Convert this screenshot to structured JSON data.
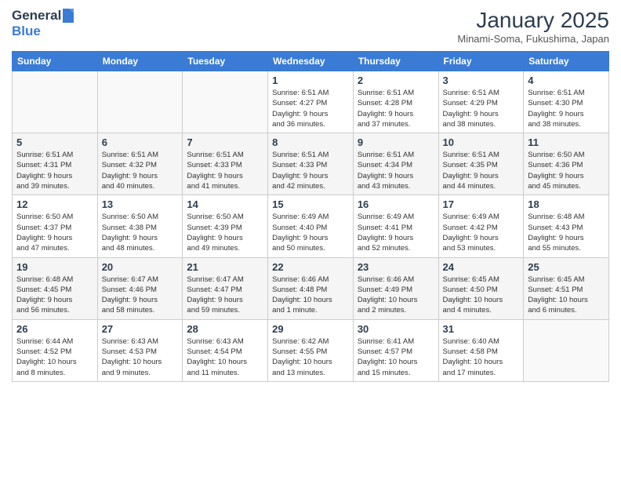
{
  "header": {
    "logo_general": "General",
    "logo_blue": "Blue",
    "title": "January 2025",
    "location": "Minami-Soma, Fukushima, Japan"
  },
  "days_of_week": [
    "Sunday",
    "Monday",
    "Tuesday",
    "Wednesday",
    "Thursday",
    "Friday",
    "Saturday"
  ],
  "weeks": [
    {
      "cells": [
        {
          "day": "",
          "info": ""
        },
        {
          "day": "",
          "info": ""
        },
        {
          "day": "",
          "info": ""
        },
        {
          "day": "1",
          "info": "Sunrise: 6:51 AM\nSunset: 4:27 PM\nDaylight: 9 hours\nand 36 minutes."
        },
        {
          "day": "2",
          "info": "Sunrise: 6:51 AM\nSunset: 4:28 PM\nDaylight: 9 hours\nand 37 minutes."
        },
        {
          "day": "3",
          "info": "Sunrise: 6:51 AM\nSunset: 4:29 PM\nDaylight: 9 hours\nand 38 minutes."
        },
        {
          "day": "4",
          "info": "Sunrise: 6:51 AM\nSunset: 4:30 PM\nDaylight: 9 hours\nand 38 minutes."
        }
      ]
    },
    {
      "cells": [
        {
          "day": "5",
          "info": "Sunrise: 6:51 AM\nSunset: 4:31 PM\nDaylight: 9 hours\nand 39 minutes."
        },
        {
          "day": "6",
          "info": "Sunrise: 6:51 AM\nSunset: 4:32 PM\nDaylight: 9 hours\nand 40 minutes."
        },
        {
          "day": "7",
          "info": "Sunrise: 6:51 AM\nSunset: 4:33 PM\nDaylight: 9 hours\nand 41 minutes."
        },
        {
          "day": "8",
          "info": "Sunrise: 6:51 AM\nSunset: 4:33 PM\nDaylight: 9 hours\nand 42 minutes."
        },
        {
          "day": "9",
          "info": "Sunrise: 6:51 AM\nSunset: 4:34 PM\nDaylight: 9 hours\nand 43 minutes."
        },
        {
          "day": "10",
          "info": "Sunrise: 6:51 AM\nSunset: 4:35 PM\nDaylight: 9 hours\nand 44 minutes."
        },
        {
          "day": "11",
          "info": "Sunrise: 6:50 AM\nSunset: 4:36 PM\nDaylight: 9 hours\nand 45 minutes."
        }
      ]
    },
    {
      "cells": [
        {
          "day": "12",
          "info": "Sunrise: 6:50 AM\nSunset: 4:37 PM\nDaylight: 9 hours\nand 47 minutes."
        },
        {
          "day": "13",
          "info": "Sunrise: 6:50 AM\nSunset: 4:38 PM\nDaylight: 9 hours\nand 48 minutes."
        },
        {
          "day": "14",
          "info": "Sunrise: 6:50 AM\nSunset: 4:39 PM\nDaylight: 9 hours\nand 49 minutes."
        },
        {
          "day": "15",
          "info": "Sunrise: 6:49 AM\nSunset: 4:40 PM\nDaylight: 9 hours\nand 50 minutes."
        },
        {
          "day": "16",
          "info": "Sunrise: 6:49 AM\nSunset: 4:41 PM\nDaylight: 9 hours\nand 52 minutes."
        },
        {
          "day": "17",
          "info": "Sunrise: 6:49 AM\nSunset: 4:42 PM\nDaylight: 9 hours\nand 53 minutes."
        },
        {
          "day": "18",
          "info": "Sunrise: 6:48 AM\nSunset: 4:43 PM\nDaylight: 9 hours\nand 55 minutes."
        }
      ]
    },
    {
      "cells": [
        {
          "day": "19",
          "info": "Sunrise: 6:48 AM\nSunset: 4:45 PM\nDaylight: 9 hours\nand 56 minutes."
        },
        {
          "day": "20",
          "info": "Sunrise: 6:47 AM\nSunset: 4:46 PM\nDaylight: 9 hours\nand 58 minutes."
        },
        {
          "day": "21",
          "info": "Sunrise: 6:47 AM\nSunset: 4:47 PM\nDaylight: 9 hours\nand 59 minutes."
        },
        {
          "day": "22",
          "info": "Sunrise: 6:46 AM\nSunset: 4:48 PM\nDaylight: 10 hours\nand 1 minute."
        },
        {
          "day": "23",
          "info": "Sunrise: 6:46 AM\nSunset: 4:49 PM\nDaylight: 10 hours\nand 2 minutes."
        },
        {
          "day": "24",
          "info": "Sunrise: 6:45 AM\nSunset: 4:50 PM\nDaylight: 10 hours\nand 4 minutes."
        },
        {
          "day": "25",
          "info": "Sunrise: 6:45 AM\nSunset: 4:51 PM\nDaylight: 10 hours\nand 6 minutes."
        }
      ]
    },
    {
      "cells": [
        {
          "day": "26",
          "info": "Sunrise: 6:44 AM\nSunset: 4:52 PM\nDaylight: 10 hours\nand 8 minutes."
        },
        {
          "day": "27",
          "info": "Sunrise: 6:43 AM\nSunset: 4:53 PM\nDaylight: 10 hours\nand 9 minutes."
        },
        {
          "day": "28",
          "info": "Sunrise: 6:43 AM\nSunset: 4:54 PM\nDaylight: 10 hours\nand 11 minutes."
        },
        {
          "day": "29",
          "info": "Sunrise: 6:42 AM\nSunset: 4:55 PM\nDaylight: 10 hours\nand 13 minutes."
        },
        {
          "day": "30",
          "info": "Sunrise: 6:41 AM\nSunset: 4:57 PM\nDaylight: 10 hours\nand 15 minutes."
        },
        {
          "day": "31",
          "info": "Sunrise: 6:40 AM\nSunset: 4:58 PM\nDaylight: 10 hours\nand 17 minutes."
        },
        {
          "day": "",
          "info": ""
        }
      ]
    }
  ]
}
